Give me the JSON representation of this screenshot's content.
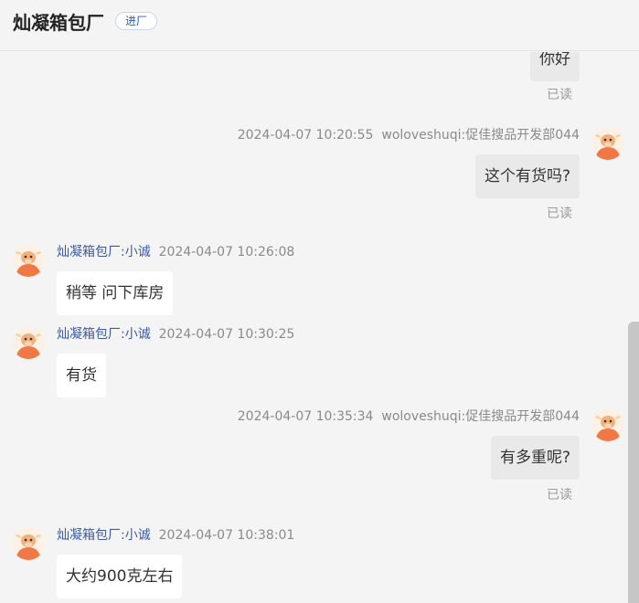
{
  "header": {
    "title": "灿凝箱包厂",
    "tag": "进厂"
  },
  "messages": [
    {
      "direction": "out",
      "text": "你好",
      "read": "已读"
    },
    {
      "direction": "out",
      "time": "2024-04-07 10:20:55",
      "sender": "woloveshuqi:促佳搜品开发部044",
      "text": "这个有货吗?",
      "read": "已读"
    },
    {
      "direction": "in",
      "sender": "灿凝箱包厂:小诚",
      "time": "2024-04-07 10:26:08",
      "text": "稍等 问下库房"
    },
    {
      "direction": "in",
      "sender": "灿凝箱包厂:小诚",
      "time": "2024-04-07 10:30:25",
      "text": "有货"
    },
    {
      "direction": "out",
      "time": "2024-04-07 10:35:34",
      "sender": "woloveshuqi:促佳搜品开发部044",
      "text": "有多重呢?",
      "read": "已读"
    },
    {
      "direction": "in",
      "sender": "灿凝箱包厂:小诚",
      "time": "2024-04-07 10:38:01",
      "text": "大约900克左右"
    }
  ],
  "colors": {
    "sender_name": "#3c5aa6",
    "in_bubble": "#ffffff",
    "out_bubble": "#e9e9e9",
    "avatar": "#f07845"
  },
  "icons": {
    "avatar": "cow-cartoon-avatar-icon"
  }
}
